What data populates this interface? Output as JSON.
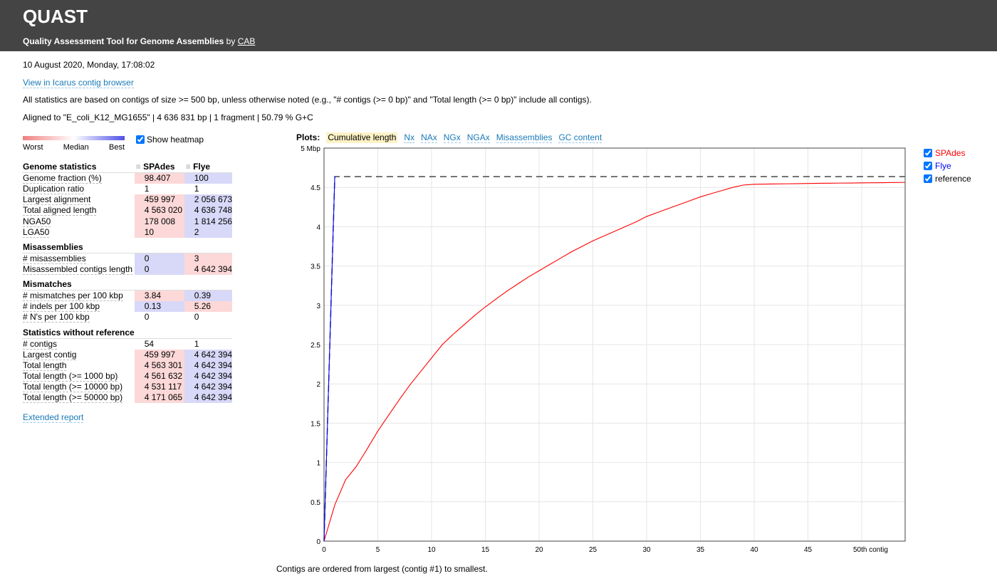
{
  "header": {
    "title": "QUAST",
    "subtitle": "Quality Assessment Tool for Genome Assemblies",
    "by": "by",
    "author_link": "CAB"
  },
  "date": "10 August 2020, Monday, 17:08:02",
  "icarus_link": "View in Icarus contig browser",
  "note_stats": "All statistics are based on contigs of size >= 500 bp, unless otherwise noted (e.g., \"# contigs (>= 0 bp)\" and \"Total length (>= 0 bp)\" include all contigs).",
  "aligned_to": "Aligned to \"E_coli_K12_MG1655\" | 4 636 831 bp | 1 fragment | 50.79 % G+C",
  "heatmap": {
    "worst": "Worst",
    "median": "Median",
    "best": "Best",
    "show_label": "Show heatmap",
    "checked": true,
    "colors": {
      "worst": "#f08080",
      "best": "#5050e8"
    }
  },
  "table": {
    "columns": [
      "SPAdes",
      "Flye"
    ],
    "groups": [
      {
        "title": "Genome statistics",
        "rows": [
          {
            "label": "Genome fraction (%)",
            "values": [
              "98.407",
              "100"
            ],
            "heat": [
              "red",
              "blue"
            ]
          },
          {
            "label": "Duplication ratio",
            "values": [
              "1",
              "1"
            ],
            "heat": [
              "",
              ""
            ]
          },
          {
            "label": "Largest alignment",
            "values": [
              "459 997",
              "2 056 673"
            ],
            "heat": [
              "red",
              "blue"
            ]
          },
          {
            "label": "Total aligned length",
            "values": [
              "4 563 020",
              "4 636 748"
            ],
            "heat": [
              "red",
              "blue"
            ]
          },
          {
            "label": "NGA50",
            "values": [
              "178 008",
              "1 814 256"
            ],
            "heat": [
              "red",
              "blue"
            ]
          },
          {
            "label": "LGA50",
            "values": [
              "10",
              "2"
            ],
            "heat": [
              "red",
              "blue"
            ]
          }
        ]
      },
      {
        "title": "Misassemblies",
        "rows": [
          {
            "label": "# misassemblies",
            "values": [
              "0",
              "3"
            ],
            "heat": [
              "blue",
              "red"
            ]
          },
          {
            "label": "Misassembled contigs length",
            "values": [
              "0",
              "4 642 394"
            ],
            "heat": [
              "blue",
              "red"
            ]
          }
        ]
      },
      {
        "title": "Mismatches",
        "rows": [
          {
            "label": "# mismatches per 100 kbp",
            "values": [
              "3.84",
              "0.39"
            ],
            "heat": [
              "red",
              "blue"
            ]
          },
          {
            "label": "# indels per 100 kbp",
            "values": [
              "0.13",
              "5.26"
            ],
            "heat": [
              "blue",
              "red"
            ]
          },
          {
            "label": "# N's per 100 kbp",
            "values": [
              "0",
              "0"
            ],
            "heat": [
              "",
              ""
            ]
          }
        ]
      },
      {
        "title": "Statistics without reference",
        "rows": [
          {
            "label": "# contigs",
            "values": [
              "54",
              "1"
            ],
            "heat": [
              "",
              ""
            ]
          },
          {
            "label": "Largest contig",
            "values": [
              "459 997",
              "4 642 394"
            ],
            "heat": [
              "red",
              "blue"
            ]
          },
          {
            "label": "Total length",
            "values": [
              "4 563 301",
              "4 642 394"
            ],
            "heat": [
              "red",
              "blue"
            ]
          },
          {
            "label": "Total length (>= 1000 bp)",
            "values": [
              "4 561 632",
              "4 642 394"
            ],
            "heat": [
              "red",
              "blue"
            ]
          },
          {
            "label": "Total length (>= 10000 bp)",
            "values": [
              "4 531 117",
              "4 642 394"
            ],
            "heat": [
              "red",
              "blue"
            ]
          },
          {
            "label": "Total length (>= 50000 bp)",
            "values": [
              "4 171 065",
              "4 642 394"
            ],
            "heat": [
              "red",
              "blue"
            ]
          }
        ]
      }
    ]
  },
  "extended_report": "Extended report",
  "plots": {
    "label": "Plots:",
    "tabs": [
      "Cumulative length",
      "Nx",
      "NAx",
      "NGx",
      "NGAx",
      "Misassemblies",
      "GC content"
    ],
    "selected": 0
  },
  "footer_note": "Contigs are ordered from largest (contig #1) to smallest.",
  "chart_data": {
    "type": "line",
    "xlabel_last_tick": "50th contig",
    "x_ticks": [
      "0",
      "5",
      "10",
      "15",
      "20",
      "25",
      "30",
      "35",
      "40",
      "45",
      "50th contig"
    ],
    "y_ticks": [
      "0",
      "0.5",
      "1",
      "1.5",
      "2",
      "2.5",
      "3",
      "3.5",
      "4",
      "4.5",
      "5 Mbp"
    ],
    "xlim": [
      0,
      54
    ],
    "ylim": [
      0,
      5
    ],
    "grid": true,
    "series": [
      {
        "name": "SPAdes",
        "color": "#ff0000",
        "dash": false,
        "x": [
          0,
          1,
          2,
          3,
          4,
          5,
          6,
          7,
          8,
          9,
          10,
          11,
          12,
          13,
          14,
          15,
          16,
          17,
          18,
          19,
          20,
          21,
          22,
          23,
          24,
          25,
          26,
          27,
          28,
          29,
          30,
          31,
          32,
          33,
          34,
          35,
          36,
          37,
          38,
          39,
          40,
          41,
          42,
          43,
          44,
          45,
          46,
          47,
          48,
          49,
          50,
          51,
          52,
          53,
          54
        ],
        "y": [
          0,
          0.46,
          0.78,
          0.95,
          1.17,
          1.4,
          1.6,
          1.8,
          1.99,
          2.16,
          2.33,
          2.5,
          2.63,
          2.75,
          2.87,
          2.98,
          3.08,
          3.18,
          3.27,
          3.36,
          3.44,
          3.52,
          3.6,
          3.68,
          3.75,
          3.82,
          3.88,
          3.94,
          4.0,
          4.06,
          4.13,
          4.18,
          4.23,
          4.28,
          4.33,
          4.38,
          4.42,
          4.46,
          4.5,
          4.53,
          4.54,
          4.542,
          4.544,
          4.546,
          4.548,
          4.55,
          4.552,
          4.553,
          4.555,
          4.556,
          4.558,
          4.559,
          4.56,
          4.562,
          4.563
        ]
      },
      {
        "name": "Flye",
        "color": "#0000ff",
        "dash": false,
        "x": [
          0,
          1
        ],
        "y": [
          0,
          4.642
        ]
      },
      {
        "name": "reference",
        "color": "#000000",
        "dash": true,
        "x": [
          0,
          1,
          54
        ],
        "y": [
          0,
          4.637,
          4.637
        ]
      }
    ]
  }
}
